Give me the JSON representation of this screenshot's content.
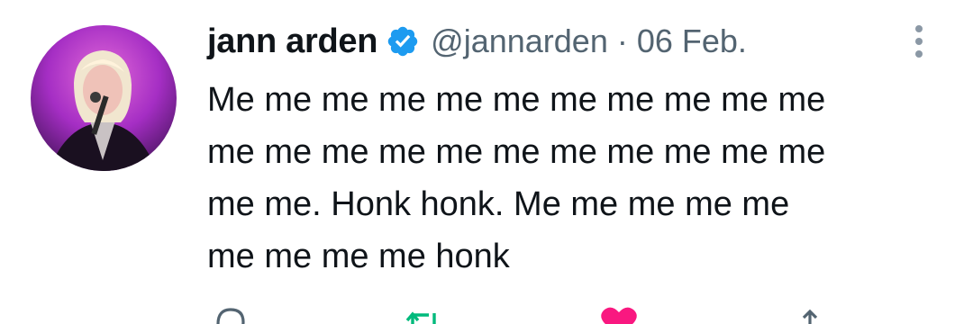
{
  "author": {
    "display_name": "jann arden",
    "handle": "@jannarden",
    "separator": "·",
    "date": "06 Feb.",
    "verified": true
  },
  "tweet": {
    "lines": [
      "Me me me me me me me me me me me",
      "me me me me me me me me me me me",
      "me me. Honk honk. Me me me me me",
      "me me me me honk"
    ]
  },
  "icons": {
    "avatar": "avatar-photo",
    "verified": "verified-badge-icon",
    "more": "more-vertical-icon",
    "reply": "reply-icon",
    "retweet": "retweet-icon",
    "like": "like-heart-icon",
    "share": "share-icon"
  },
  "colors": {
    "text": "#0f1419",
    "secondary": "#536471",
    "verified": "#1d9bf0",
    "retweet": "#00ba7c",
    "like": "#f91880"
  }
}
